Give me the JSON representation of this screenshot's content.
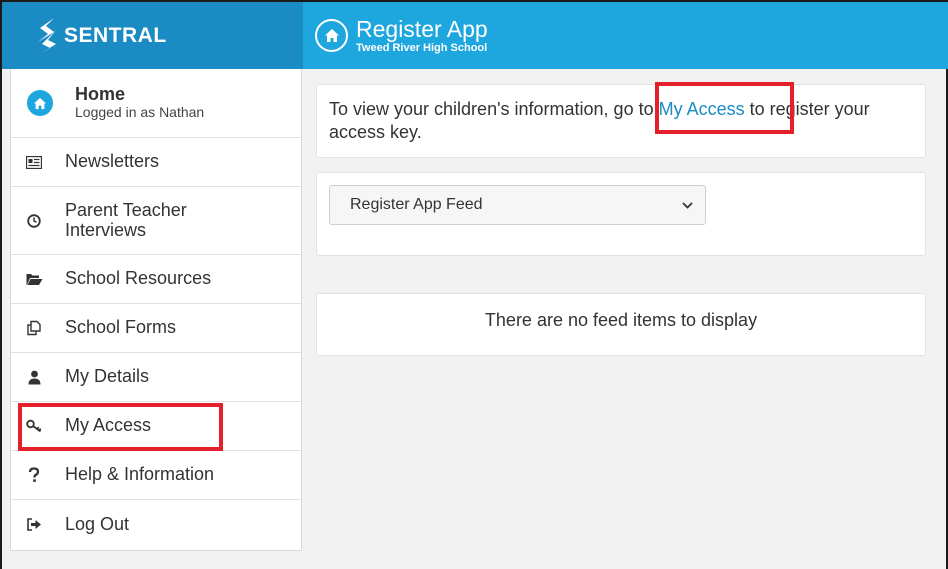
{
  "header": {
    "brand": "SENTRAL",
    "app_title": "Register App",
    "app_subtitle": "Tweed River High School"
  },
  "sidebar": {
    "home": {
      "title": "Home",
      "subtitle": "Logged in as Nathan"
    },
    "items": [
      {
        "label": "Newsletters",
        "icon": "newspaper-icon"
      },
      {
        "label": "Parent Teacher Interviews",
        "icon": "clock-icon"
      },
      {
        "label": "School Resources",
        "icon": "folder-open-icon"
      },
      {
        "label": "School Forms",
        "icon": "copy-forms-icon"
      },
      {
        "label": "My Details",
        "icon": "user-icon"
      },
      {
        "label": "My Access",
        "icon": "key-icon"
      },
      {
        "label": "Help & Information",
        "icon": "question-icon"
      },
      {
        "label": "Log Out",
        "icon": "sign-out-icon"
      }
    ]
  },
  "main": {
    "info_before": "To view your children's information, go to ",
    "info_link": "My Access",
    "info_after": " to register your access key.",
    "feed_select": {
      "selected": "Register App Feed"
    },
    "empty_message": "There are no feed items to display"
  },
  "colors": {
    "brand_bar": "#1b8bc3",
    "app_bar": "#1ea6de",
    "link": "#1b8bc3",
    "highlight": "#e4202a"
  }
}
